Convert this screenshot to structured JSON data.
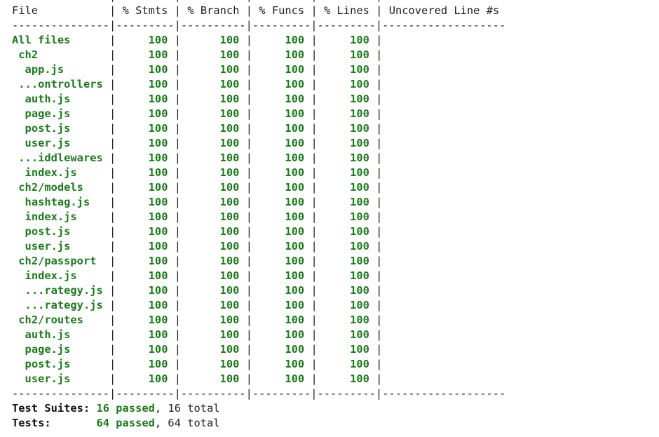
{
  "coverage_table": {
    "separator": "---------------|---------|----------|---------|---------|-------------------",
    "headers": {
      "file": "File",
      "stmts": "% Stmts",
      "branch": "% Branch",
      "funcs": "% Funcs",
      "lines": "% Lines",
      "uncovered": "Uncovered Line #s"
    },
    "rows": [
      {
        "name": "All files",
        "indent": 0,
        "stmts": "100",
        "branch": "100",
        "funcs": "100",
        "lines": "100",
        "uncovered": ""
      },
      {
        "name": "ch2",
        "indent": 1,
        "stmts": "100",
        "branch": "100",
        "funcs": "100",
        "lines": "100",
        "uncovered": ""
      },
      {
        "name": "app.js",
        "indent": 2,
        "stmts": "100",
        "branch": "100",
        "funcs": "100",
        "lines": "100",
        "uncovered": ""
      },
      {
        "name": "...ontrollers",
        "indent": 1,
        "stmts": "100",
        "branch": "100",
        "funcs": "100",
        "lines": "100",
        "uncovered": ""
      },
      {
        "name": "auth.js",
        "indent": 2,
        "stmts": "100",
        "branch": "100",
        "funcs": "100",
        "lines": "100",
        "uncovered": ""
      },
      {
        "name": "page.js",
        "indent": 2,
        "stmts": "100",
        "branch": "100",
        "funcs": "100",
        "lines": "100",
        "uncovered": ""
      },
      {
        "name": "post.js",
        "indent": 2,
        "stmts": "100",
        "branch": "100",
        "funcs": "100",
        "lines": "100",
        "uncovered": ""
      },
      {
        "name": "user.js",
        "indent": 2,
        "stmts": "100",
        "branch": "100",
        "funcs": "100",
        "lines": "100",
        "uncovered": ""
      },
      {
        "name": "...iddlewares",
        "indent": 1,
        "stmts": "100",
        "branch": "100",
        "funcs": "100",
        "lines": "100",
        "uncovered": ""
      },
      {
        "name": "index.js",
        "indent": 2,
        "stmts": "100",
        "branch": "100",
        "funcs": "100",
        "lines": "100",
        "uncovered": ""
      },
      {
        "name": "ch2/models",
        "indent": 1,
        "stmts": "100",
        "branch": "100",
        "funcs": "100",
        "lines": "100",
        "uncovered": ""
      },
      {
        "name": "hashtag.js",
        "indent": 2,
        "stmts": "100",
        "branch": "100",
        "funcs": "100",
        "lines": "100",
        "uncovered": ""
      },
      {
        "name": "index.js",
        "indent": 2,
        "stmts": "100",
        "branch": "100",
        "funcs": "100",
        "lines": "100",
        "uncovered": ""
      },
      {
        "name": "post.js",
        "indent": 2,
        "stmts": "100",
        "branch": "100",
        "funcs": "100",
        "lines": "100",
        "uncovered": ""
      },
      {
        "name": "user.js",
        "indent": 2,
        "stmts": "100",
        "branch": "100",
        "funcs": "100",
        "lines": "100",
        "uncovered": ""
      },
      {
        "name": "ch2/passport",
        "indent": 1,
        "stmts": "100",
        "branch": "100",
        "funcs": "100",
        "lines": "100",
        "uncovered": ""
      },
      {
        "name": "index.js",
        "indent": 2,
        "stmts": "100",
        "branch": "100",
        "funcs": "100",
        "lines": "100",
        "uncovered": ""
      },
      {
        "name": "...rategy.js",
        "indent": 2,
        "stmts": "100",
        "branch": "100",
        "funcs": "100",
        "lines": "100",
        "uncovered": ""
      },
      {
        "name": "...rategy.js",
        "indent": 2,
        "stmts": "100",
        "branch": "100",
        "funcs": "100",
        "lines": "100",
        "uncovered": ""
      },
      {
        "name": "ch2/routes",
        "indent": 1,
        "stmts": "100",
        "branch": "100",
        "funcs": "100",
        "lines": "100",
        "uncovered": ""
      },
      {
        "name": "auth.js",
        "indent": 2,
        "stmts": "100",
        "branch": "100",
        "funcs": "100",
        "lines": "100",
        "uncovered": ""
      },
      {
        "name": "page.js",
        "indent": 2,
        "stmts": "100",
        "branch": "100",
        "funcs": "100",
        "lines": "100",
        "uncovered": ""
      },
      {
        "name": "post.js",
        "indent": 2,
        "stmts": "100",
        "branch": "100",
        "funcs": "100",
        "lines": "100",
        "uncovered": ""
      },
      {
        "name": "user.js",
        "indent": 2,
        "stmts": "100",
        "branch": "100",
        "funcs": "100",
        "lines": "100",
        "uncovered": ""
      }
    ]
  },
  "summary": {
    "suites": {
      "label": "Test Suites:",
      "passed": "16 passed",
      "total": ", 16 total"
    },
    "tests": {
      "label": "Tests:",
      "passed": "64 passed",
      "total": ", 64 total"
    }
  },
  "colors": {
    "pass_green": "#1e7a1e",
    "text": "#222222",
    "background": "#ffffff"
  }
}
